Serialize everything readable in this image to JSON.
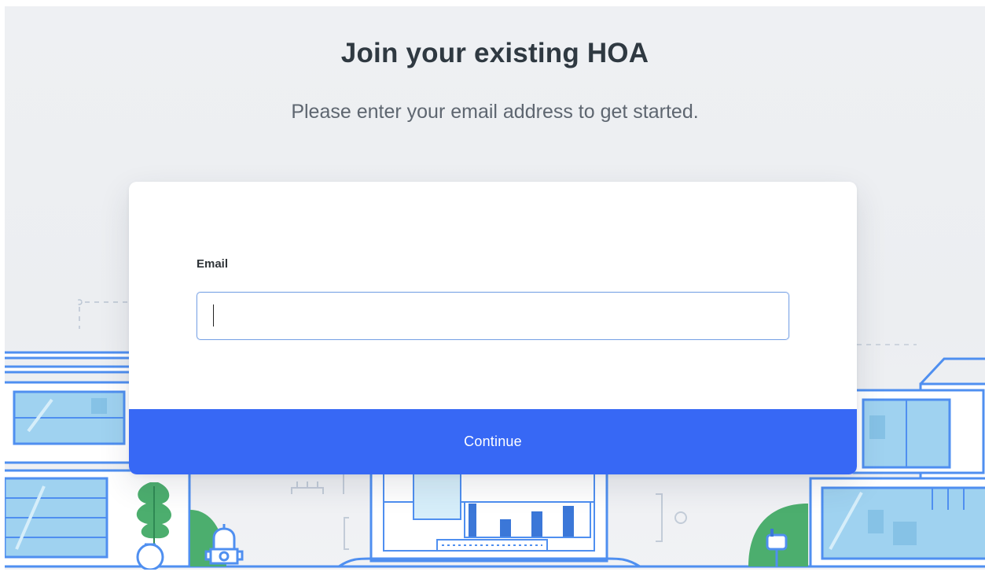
{
  "header": {
    "title": "Join your existing HOA",
    "subtitle": "Please enter your email address to get started."
  },
  "form": {
    "email_label": "Email",
    "email_value": "",
    "email_placeholder": "",
    "continue_label": "Continue"
  },
  "colors": {
    "accent": "#3768f5",
    "illustration_line": "#4f8ff0",
    "illustration_fill": "#9fd2f0",
    "plant_green": "#4cae6e",
    "background": "#eef0f3"
  },
  "illustration": {
    "icons": [
      "house-icon",
      "house-icon",
      "laptop-icon",
      "plant-icon",
      "fire-hydrant-icon",
      "mailbox-icon",
      "tree-icon"
    ]
  }
}
